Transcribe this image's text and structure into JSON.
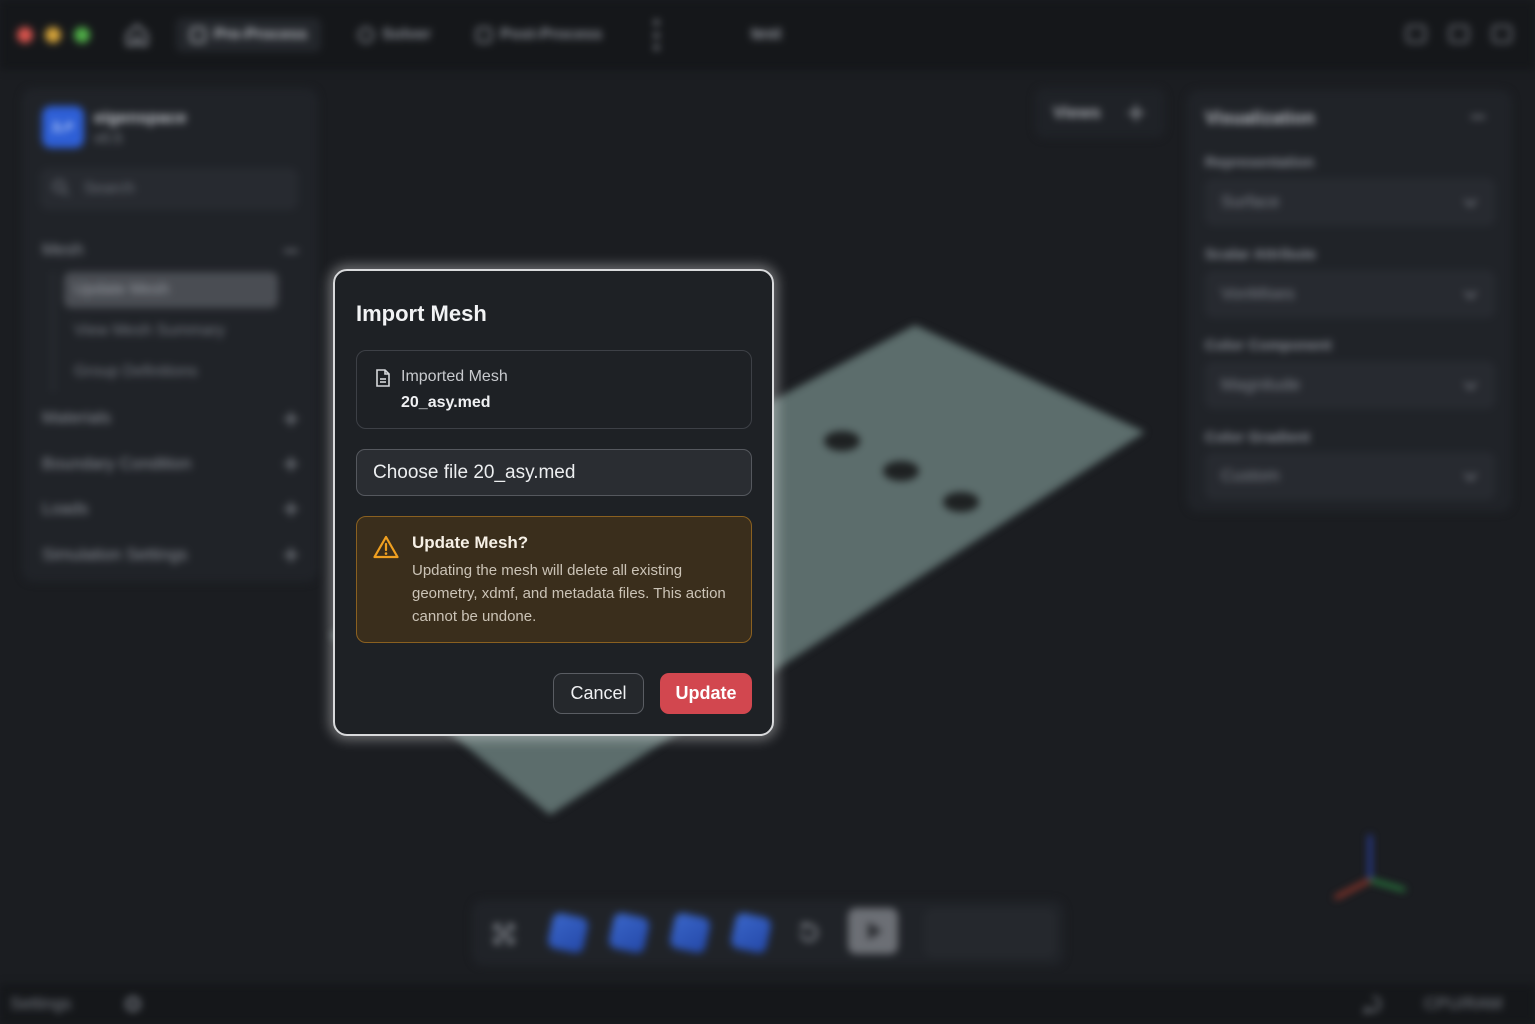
{
  "window": {
    "title": "test",
    "tabs": [
      {
        "label": "Pre-Process",
        "active": true
      },
      {
        "label": "Solver",
        "active": false
      },
      {
        "label": "Post-Process",
        "active": false
      }
    ]
  },
  "sidebar": {
    "brand_name": "eigenspace",
    "brand_version": "v0.5",
    "search_placeholder": "Search",
    "sections": [
      {
        "label": "Mesh",
        "expanded": true,
        "items": [
          "Update Mesh",
          "View Mesh Summary",
          "Group Definitions"
        ],
        "active_item": "Update Mesh"
      },
      {
        "label": "Materials",
        "expanded": false
      },
      {
        "label": "Boundary Condition",
        "expanded": false
      },
      {
        "label": "Loads",
        "expanded": false
      },
      {
        "label": "Simulation Settings",
        "expanded": false
      }
    ]
  },
  "views": {
    "label": "Views"
  },
  "visualization": {
    "title": "Visualization",
    "fields": [
      {
        "label": "Representation",
        "value": "Surface"
      },
      {
        "label": "Scalar Attribute",
        "value": "VonMises"
      },
      {
        "label": "Color Component",
        "value": "Magnitude"
      },
      {
        "label": "Color Gradient",
        "value": "Custom"
      }
    ]
  },
  "statusbar": {
    "settings_label": "Settings",
    "cpu_label": "CPU/RAM"
  },
  "dialog": {
    "title": "Import Mesh",
    "file_label": "Imported Mesh",
    "file_name": "20_asy.med",
    "choose_file_text": "Choose file 20_asy.med",
    "warning_title": "Update Mesh?",
    "warning_text": "Updating the mesh will delete all existing geometry, xdmf, and metadata files. This action cannot be undone.",
    "cancel_label": "Cancel",
    "update_label": "Update"
  },
  "colors": {
    "accent_danger": "#d2474f",
    "warning_bg": "#3a2e1c",
    "warning_border": "#8a6020",
    "warning_icon": "#f0a020",
    "brand_blue": "#2e5fd6"
  },
  "icons": [
    "home-icon",
    "file-icon",
    "warning-icon",
    "search-icon",
    "gear-icon",
    "chat-icon",
    "play-icon",
    "reset-icon",
    "fit-view-icon",
    "axes-triad-icon"
  ]
}
